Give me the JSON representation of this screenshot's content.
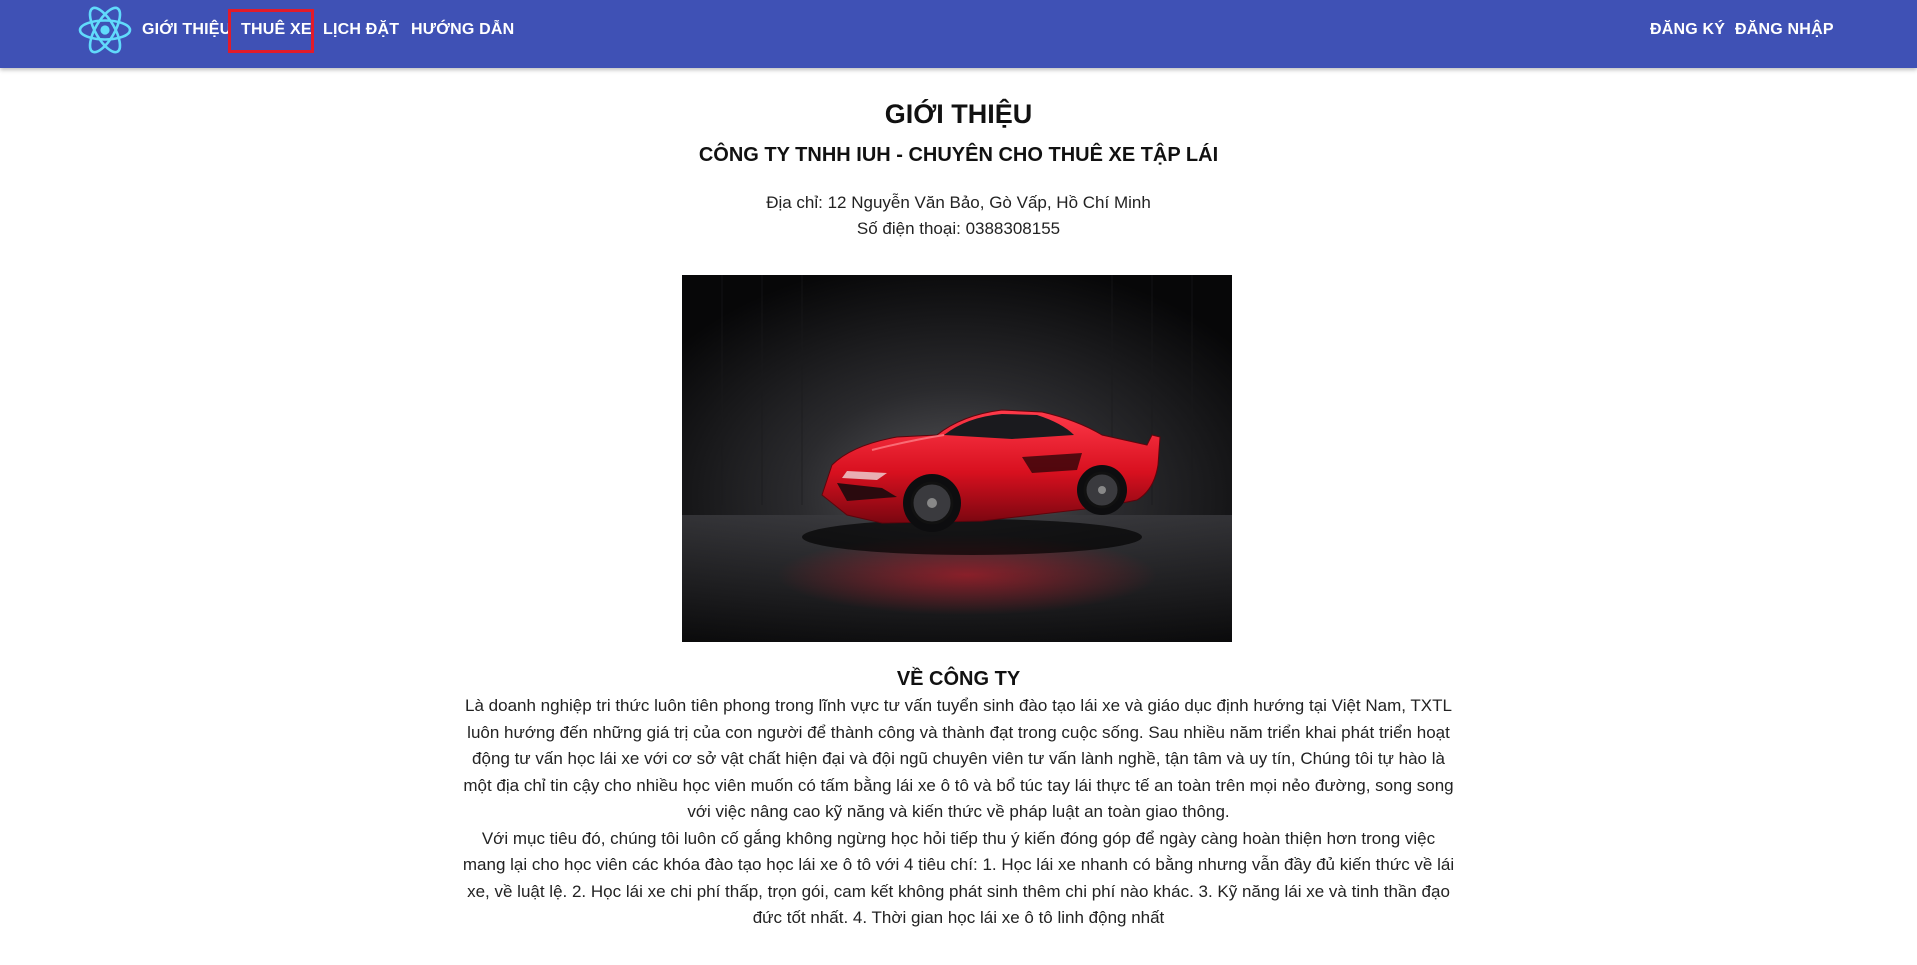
{
  "navbar": {
    "brand_icon": "react-logo-icon",
    "color": "#3f51b5",
    "left_items": [
      "GIỚI THIỆU",
      "THUÊ XE",
      "LỊCH ĐẶT",
      "HƯỚNG DẪN"
    ],
    "right_items": [
      "ĐĂNG KÝ",
      "ĐĂNG NHẬP"
    ],
    "highlighted_item": "THUÊ XE",
    "highlight_color": "#e21b2a"
  },
  "main": {
    "title": "GIỚI THIỆU",
    "company": "CÔNG TY TNHH IUH - CHUYÊN CHO THUÊ XE TẬP LÁI",
    "address": "Địa chỉ: 12 Nguyễn Văn Bảo, Gò Vấp, Hồ Chí Minh",
    "phone": "Số điện thoại: 0388308155",
    "hero_image": "red-sports-car-photo",
    "about_title": "VỀ CÔNG TY",
    "about_paragraphs": [
      "Là doanh nghiệp tri thức luôn tiên phong trong lĩnh vực tư vấn tuyển sinh đào tạo lái xe và giáo dục định hướng tại Việt Nam, TXTL luôn hướng đến những giá trị của con người để thành công và thành đạt trong cuộc sống. Sau nhiều năm triển khai phát triển hoạt động tư vấn học lái xe với cơ sở vật chất hiện đại và đội ngũ chuyên viên tư vấn lành nghề, tận tâm và uy tín, Chúng tôi tự hào là một địa chỉ tin cậy cho nhiều học viên muốn có tấm bằng lái xe ô tô và bổ túc tay lái thực tế an toàn trên mọi nẻo đường, song song với việc nâng cao kỹ năng và kiến thức về pháp luật an toàn giao thông.",
      "Với mục tiêu đó, chúng tôi luôn cố gắng không ngừng học hỏi tiếp thu ý kiến đóng góp để ngày càng hoàn thiện hơn trong việc mang lại cho học viên các khóa đào tạo học lái xe ô tô với 4 tiêu chí: 1. Học lái xe nhanh có bằng nhưng vẫn đầy đủ kiến thức về lái xe, về luật lệ. 2. Học lái xe chi phí thấp, trọn gói, cam kết không phát sinh thêm chi phí nào khác. 3. Kỹ năng lái xe và tinh thần đạo đức tốt nhất. 4. Thời gian học lái xe ô tô linh động nhất"
    ]
  }
}
